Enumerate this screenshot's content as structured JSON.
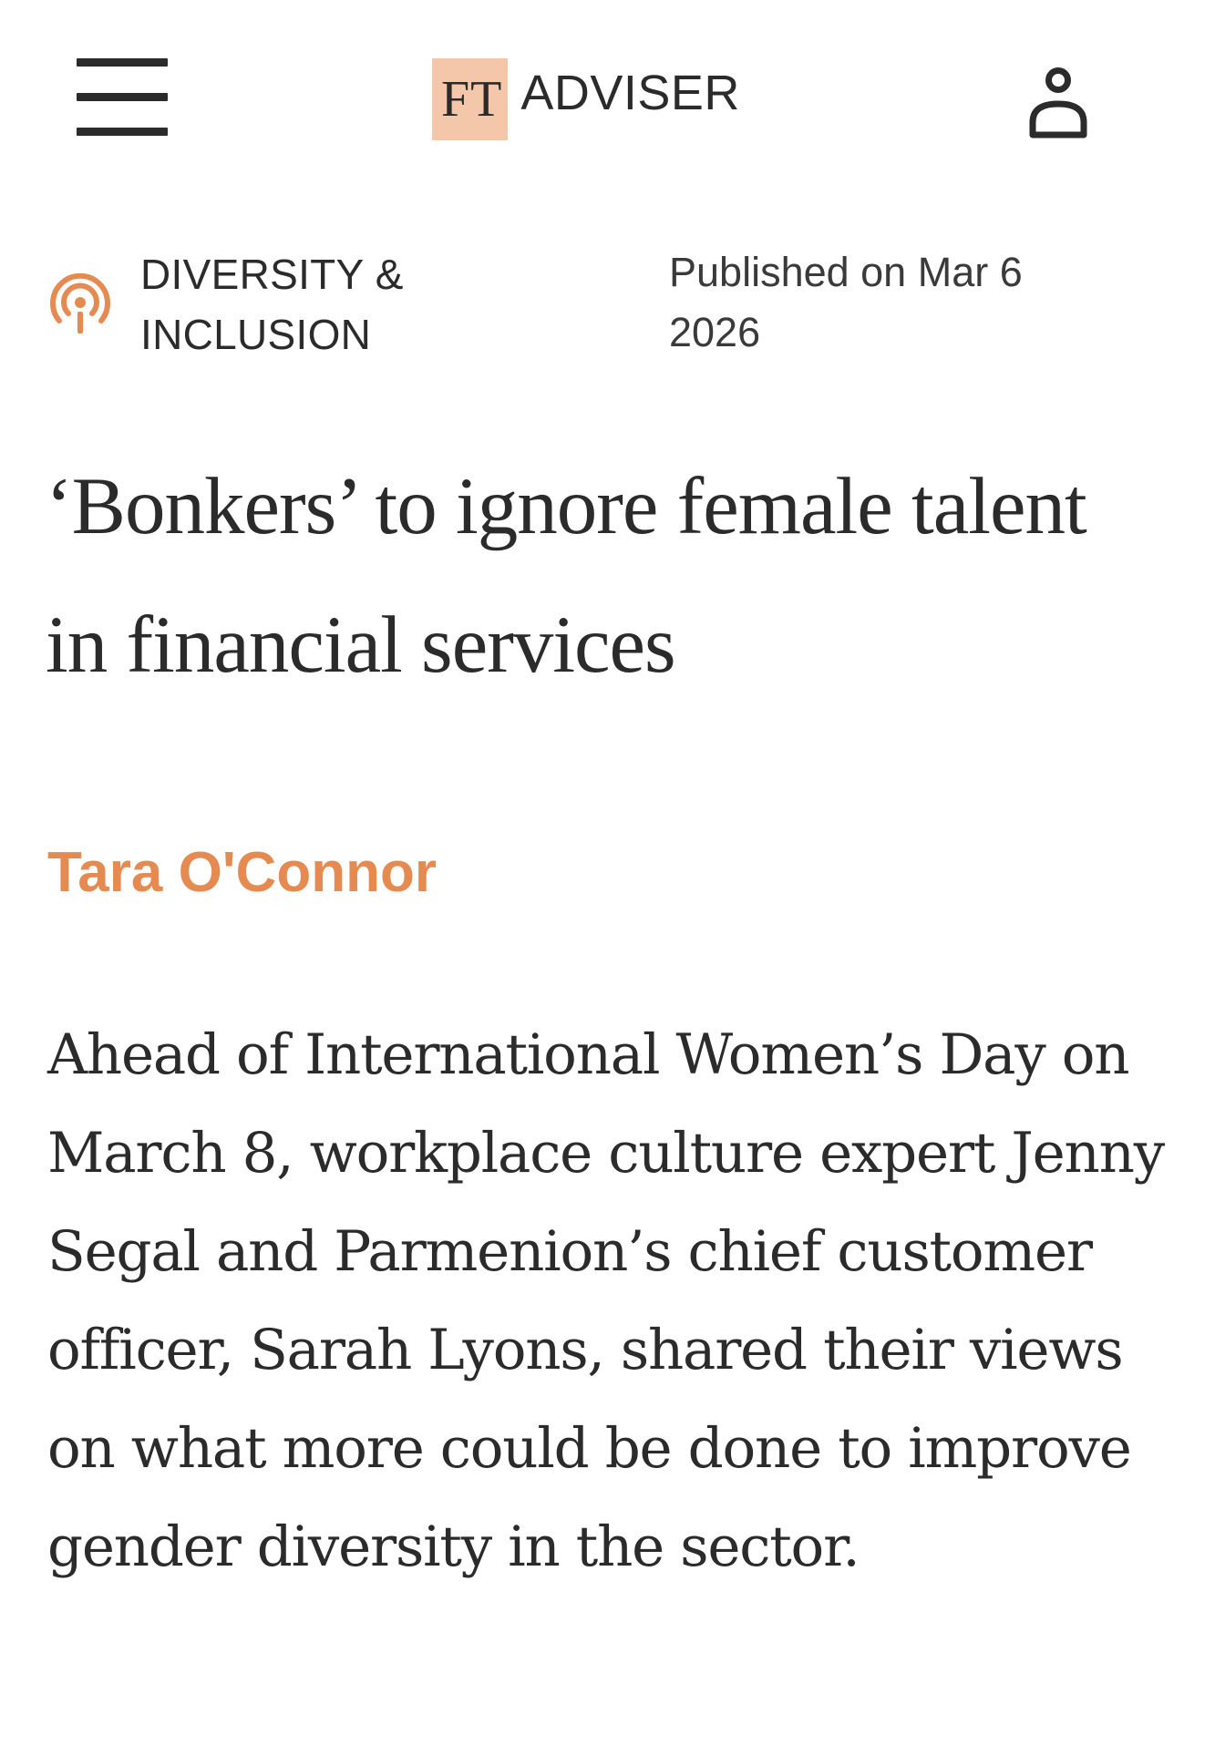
{
  "header": {
    "logo_ft": "FT",
    "logo_adviser": "ADVISER",
    "menu_icon": "hamburger-menu-icon",
    "user_icon": "user-account-icon"
  },
  "article": {
    "category": "DIVERSITY & INCLUSION",
    "category_icon": "podcast-broadcast-icon",
    "published": "Published on Mar 6 2026",
    "headline": "‘Bonkers’ to ignore female talent in financial services",
    "author": "Tara O'Connor",
    "standfirst": "Ahead of International Women’s Day on March 8, workplace culture expert Jenny Segal and Parmenion’s chief customer officer, Sarah Lyons, shared their views on what more could be done to improve gender diversity in the sector."
  },
  "colors": {
    "accent": "#e58b52",
    "logo_bg": "#f4c7aa",
    "text": "#2b2b2b",
    "background": "#ffffff"
  }
}
